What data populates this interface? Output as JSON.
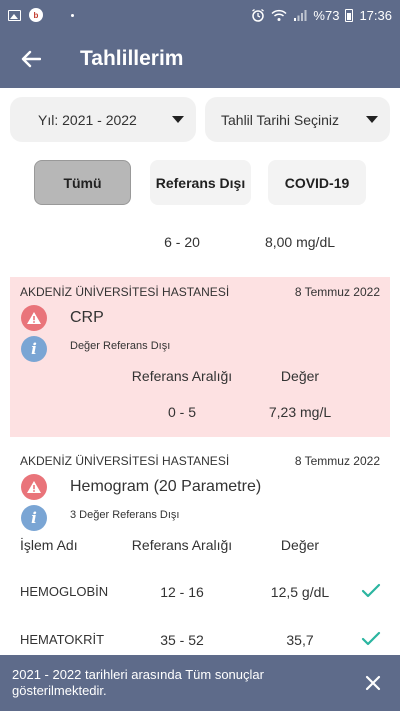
{
  "status_bar": {
    "battery": "%73",
    "time": "17:36",
    "notification_badge": "b"
  },
  "app_bar": {
    "title": "Tahlillerim"
  },
  "filters": {
    "year": "Yıl: 2021 - 2022",
    "date": "Tahlil Tarihi Seçiniz"
  },
  "tabs": [
    {
      "label": "Tümü",
      "active": true
    },
    {
      "label": "Referans Dışı",
      "active": false
    },
    {
      "label": "COVID-19",
      "active": false
    }
  ],
  "partial_row": {
    "range": "6 - 20",
    "value": "8,00 mg/dL"
  },
  "results": [
    {
      "hospital": "AKDENİZ ÜNİVERSİTESİ HASTANESİ",
      "date": "8 Temmuz 2022",
      "test": "CRP",
      "status": "Değer Referans Dışı",
      "headers": {
        "range": "Referans Aralığı",
        "value": "Değer"
      },
      "rows": [
        {
          "range": "0 - 5",
          "value": "7,23 mg/L"
        }
      ]
    },
    {
      "hospital": "AKDENİZ ÜNİVERSİTESİ HASTANESİ",
      "date": "8 Temmuz 2022",
      "test": "Hemogram (20 Parametre)",
      "status": "3 Değer Referans Dışı",
      "headers": {
        "name": "İşlem Adı",
        "range": "Referans Aralığı",
        "value": "Değer"
      },
      "rows": [
        {
          "name": "HEMOGLOBİN",
          "range": "12 - 16",
          "value": "12,5 g/dL"
        },
        {
          "name": "HEMATOKRİT",
          "range": "35 - 52",
          "value": "35,7"
        }
      ]
    }
  ],
  "snackbar": {
    "message": "2021 - 2022 tarihleri arasında Tüm sonuçlar gösterilmektedir."
  },
  "colors": {
    "primary": "#5e6b8a",
    "alert_bg": "#fde1e2",
    "warn": "#e9747a",
    "info": "#7aa5d4",
    "check": "#2bb5a0"
  }
}
